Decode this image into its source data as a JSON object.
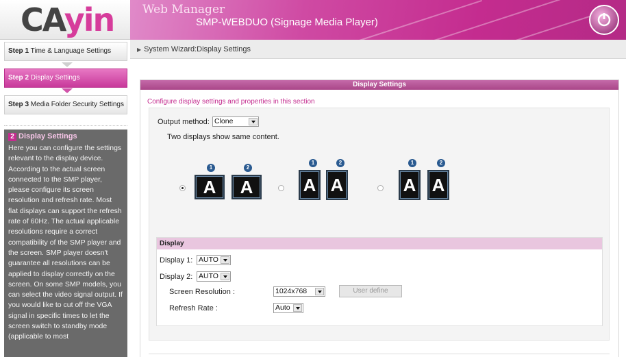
{
  "logo": {
    "part1": "CA",
    "part2": "yin"
  },
  "header": {
    "title": "Web Manager",
    "subtitle": "SMP-WEBDUO (Signage Media Player)"
  },
  "sidebar": {
    "steps": [
      {
        "num": "Step 1",
        "label": "Time & Language Settings"
      },
      {
        "num": "Step 2",
        "label": "Display Settings"
      },
      {
        "num": "Step 3",
        "label": "Media Folder Security Settings"
      }
    ],
    "help": {
      "number": "2",
      "title": "Display Settings",
      "body": "Here you can configure the settings relevant to the display device. According to the actual screen connected to the SMP player, please configure its screen resolution and refresh rate. Most flat displays can support the refresh rate of 60Hz. The actual applicable resolutions require a correct compatibility of the SMP player and the screen. SMP player doesn't guarantee all resolutions can be applied to display correctly on the screen. On some SMP models, you can select the video signal output. If you would like to cut off the VGA signal in specific times to let the screen switch to standby mode (applicable to most"
    }
  },
  "breadcrumb": {
    "text": "System Wizard:Display Settings"
  },
  "panel": {
    "title": "Display Settings",
    "description": "Configure display settings and properties in this section",
    "output_method_label": "Output method:",
    "output_method_value": "Clone",
    "output_note": "Two displays show same content.",
    "layouts": [
      {
        "monitor_letter": "A",
        "badge1": "1",
        "badge2": "2",
        "selected": true
      },
      {
        "monitor_letter": "A",
        "badge1": "1",
        "badge2": "2",
        "selected": false
      },
      {
        "monitor_letter": "A",
        "badge1": "1",
        "badge2": "2",
        "selected": false
      }
    ],
    "display": {
      "section_label": "Display",
      "display1_label": "Display 1:",
      "display1_value": "AUTO",
      "display2_label": "Display 2:",
      "display2_value": "AUTO",
      "resolution_label": "Screen Resolution :",
      "resolution_value": "1024x768",
      "user_define_label": "User define",
      "refresh_label": "Refresh Rate :",
      "refresh_value": "Auto"
    }
  },
  "colors": {
    "accent": "#c42c8f",
    "badge": "#2a5a90"
  }
}
